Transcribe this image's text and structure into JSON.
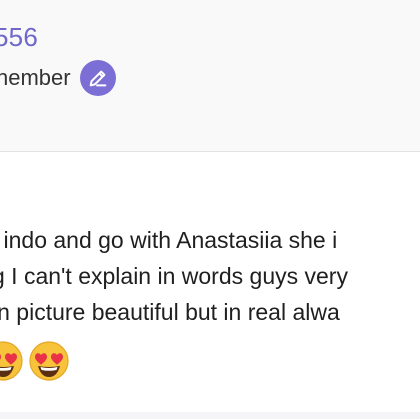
{
  "profile": {
    "username_fragment": "556",
    "member_label_fragment": "nember"
  },
  "comment": {
    "lines": [
      "l indo and go with Anastasiia she i",
      "g I can't explain in words guys very",
      "in picture beautiful but in real alwa"
    ],
    "emojis": [
      "heart-eyes-emoji",
      "heart-eyes-emoji"
    ]
  },
  "colors": {
    "username": "#6f68c9",
    "badge": "#7b6fd6",
    "header_bg": "#f9f9fa",
    "text": "#1f1f1f"
  },
  "icons": {
    "member_badge": "pencil-icon"
  }
}
